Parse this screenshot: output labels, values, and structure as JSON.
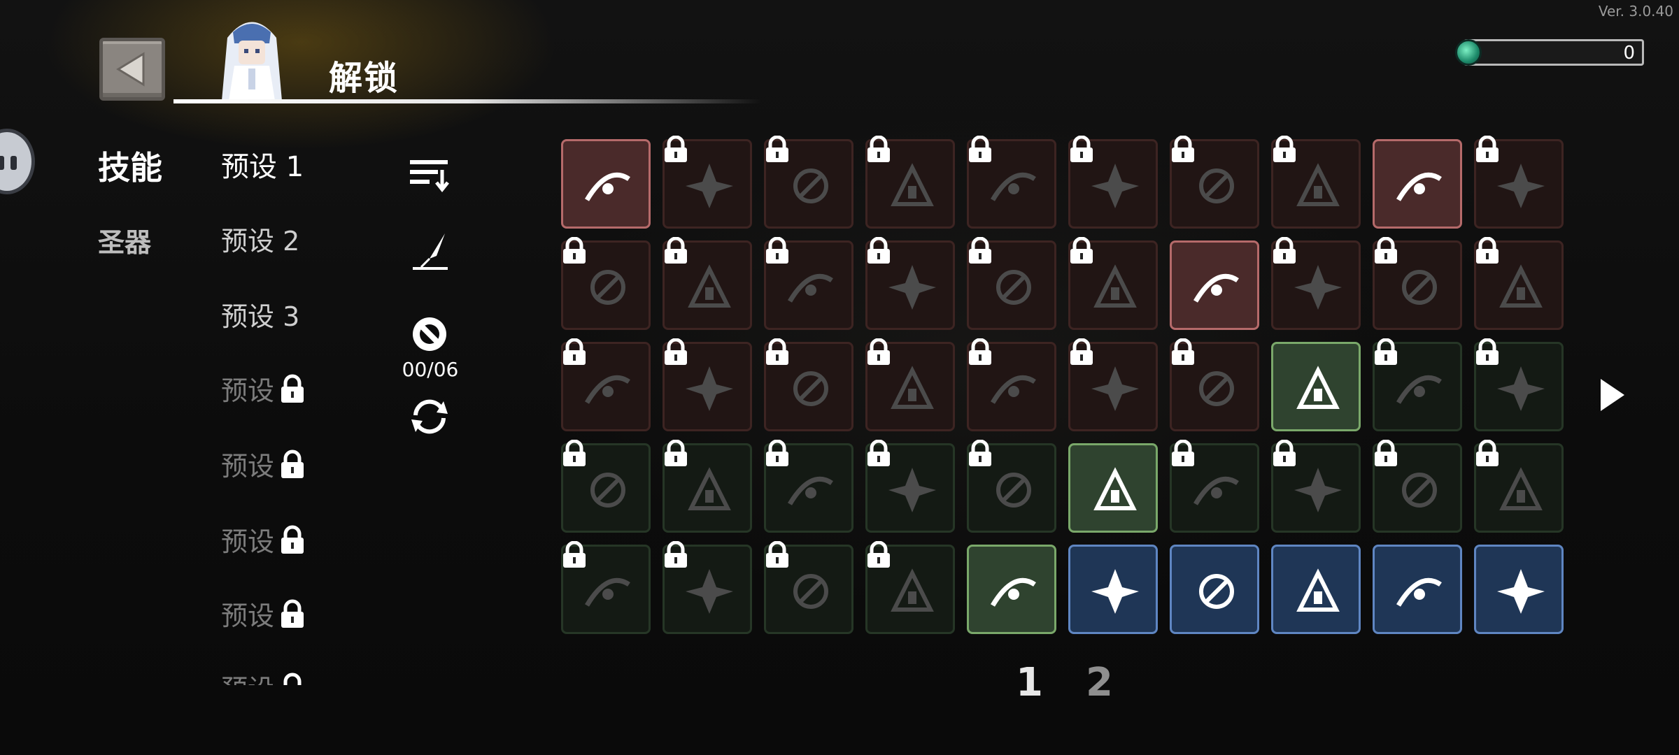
{
  "version": "Ver. 3.0.40",
  "header": {
    "title": "解锁",
    "back_icon": "back-arrow-icon"
  },
  "currency": {
    "value": "0",
    "icon": "gem-icon"
  },
  "categories": [
    {
      "label": "技能",
      "active": true
    },
    {
      "label": "圣器",
      "active": false
    }
  ],
  "presets": [
    {
      "label": "预设 1",
      "locked": false,
      "active": true
    },
    {
      "label": "预设 2",
      "locked": false
    },
    {
      "label": "预设 3",
      "locked": false
    },
    {
      "label": "预设",
      "locked": true
    },
    {
      "label": "预设",
      "locked": true
    },
    {
      "label": "预设",
      "locked": true
    },
    {
      "label": "预设",
      "locked": true
    },
    {
      "label": "预设",
      "locked": true
    }
  ],
  "tools": {
    "sort_icon": "sort-icon",
    "quill_icon": "quill-icon",
    "ban_icon": "ban-icon",
    "counter": "00/06",
    "refresh_icon": "refresh-icon"
  },
  "skills": [
    [
      {
        "tier": "red",
        "locked": false,
        "icon": "orbit-slash-icon"
      },
      {
        "tier": "red",
        "locked": true,
        "icon": "blade-icon"
      },
      {
        "tier": "red",
        "locked": true,
        "icon": "rose-icon"
      },
      {
        "tier": "red",
        "locked": true,
        "icon": "burst-icon"
      },
      {
        "tier": "red",
        "locked": true,
        "icon": "hammer-icon"
      },
      {
        "tier": "red",
        "locked": true,
        "icon": "frost-orb-icon"
      },
      {
        "tier": "red",
        "locked": true,
        "icon": "flask-icon"
      },
      {
        "tier": "red",
        "locked": true,
        "icon": "thorn-ring-icon"
      },
      {
        "tier": "red",
        "locked": false,
        "icon": "arrow-volley-icon"
      },
      {
        "tier": "red",
        "locked": true,
        "icon": "skull-icon"
      }
    ],
    [
      {
        "tier": "red",
        "locked": true,
        "icon": "crescent-icon"
      },
      {
        "tier": "red",
        "locked": true,
        "icon": "feathers-icon"
      },
      {
        "tier": "red",
        "locked": true,
        "icon": "leaf-icon"
      },
      {
        "tier": "red",
        "locked": true,
        "icon": "crosshair-icon"
      },
      {
        "tier": "red",
        "locked": true,
        "icon": "frost-sword-icon"
      },
      {
        "tier": "red",
        "locked": true,
        "icon": "spiral-icon"
      },
      {
        "tier": "red",
        "locked": false,
        "icon": "target-icon"
      },
      {
        "tier": "red",
        "locked": true,
        "icon": "spark-icon"
      },
      {
        "tier": "red",
        "locked": true,
        "icon": "cloud-icon"
      },
      {
        "tier": "red",
        "locked": true,
        "icon": "fist-icon"
      }
    ],
    [
      {
        "tier": "red",
        "locked": true,
        "icon": "vortex-icon"
      },
      {
        "tier": "red",
        "locked": true,
        "icon": "claw-icon"
      },
      {
        "tier": "red",
        "locked": true,
        "icon": "lightning-orb-icon"
      },
      {
        "tier": "red",
        "locked": true,
        "icon": "slash-icon"
      },
      {
        "tier": "red",
        "locked": true,
        "icon": "spear-icon"
      },
      {
        "tier": "red",
        "locked": true,
        "icon": "cross-slash-icon"
      },
      {
        "tier": "red",
        "locked": true,
        "icon": "pulse-icon"
      },
      {
        "tier": "green",
        "locked": false,
        "icon": "impact-icon"
      },
      {
        "tier": "green",
        "locked": true,
        "icon": "bone-icon"
      },
      {
        "tier": "green",
        "locked": true,
        "icon": "vine-icon"
      }
    ],
    [
      {
        "tier": "green",
        "locked": true,
        "icon": "figure-icon"
      },
      {
        "tier": "green",
        "locked": true,
        "icon": "fire-icon"
      },
      {
        "tier": "green",
        "locked": true,
        "icon": "skull-burst-icon"
      },
      {
        "tier": "green",
        "locked": true,
        "icon": "biohazard-icon"
      },
      {
        "tier": "green",
        "locked": true,
        "icon": "beam-icon"
      },
      {
        "tier": "green",
        "locked": false,
        "icon": "flame-potion-icon"
      },
      {
        "tier": "green",
        "locked": true,
        "icon": "scythe-icon"
      },
      {
        "tier": "green",
        "locked": true,
        "icon": "daggers-icon"
      },
      {
        "tier": "green",
        "locked": true,
        "icon": "wings-icon"
      },
      {
        "tier": "green",
        "locked": true,
        "icon": "web-icon"
      }
    ],
    [
      {
        "tier": "green",
        "locked": true,
        "icon": "splatter-icon"
      },
      {
        "tier": "green",
        "locked": true,
        "icon": "drill-icon"
      },
      {
        "tier": "green",
        "locked": true,
        "icon": "shuriken-icon"
      },
      {
        "tier": "green",
        "locked": true,
        "icon": "gear-icon"
      },
      {
        "tier": "green",
        "locked": false,
        "icon": "lightning-slash-icon"
      },
      {
        "tier": "blue",
        "locked": false,
        "icon": "shield-core-icon"
      },
      {
        "tier": "blue",
        "locked": false,
        "icon": "ghost-fire-icon"
      },
      {
        "tier": "blue",
        "locked": false,
        "icon": "hourglass-up-icon"
      },
      {
        "tier": "blue",
        "locked": false,
        "icon": "boot-up-icon"
      },
      {
        "tier": "blue",
        "locked": false,
        "icon": "sword-up-icon"
      }
    ]
  ],
  "pagination": {
    "pages": [
      "1",
      "2"
    ],
    "current": "1"
  },
  "colors": {
    "red_tier": "#b56a6a",
    "green_tier": "#7aa86a",
    "blue_tier": "#5f86c2"
  }
}
